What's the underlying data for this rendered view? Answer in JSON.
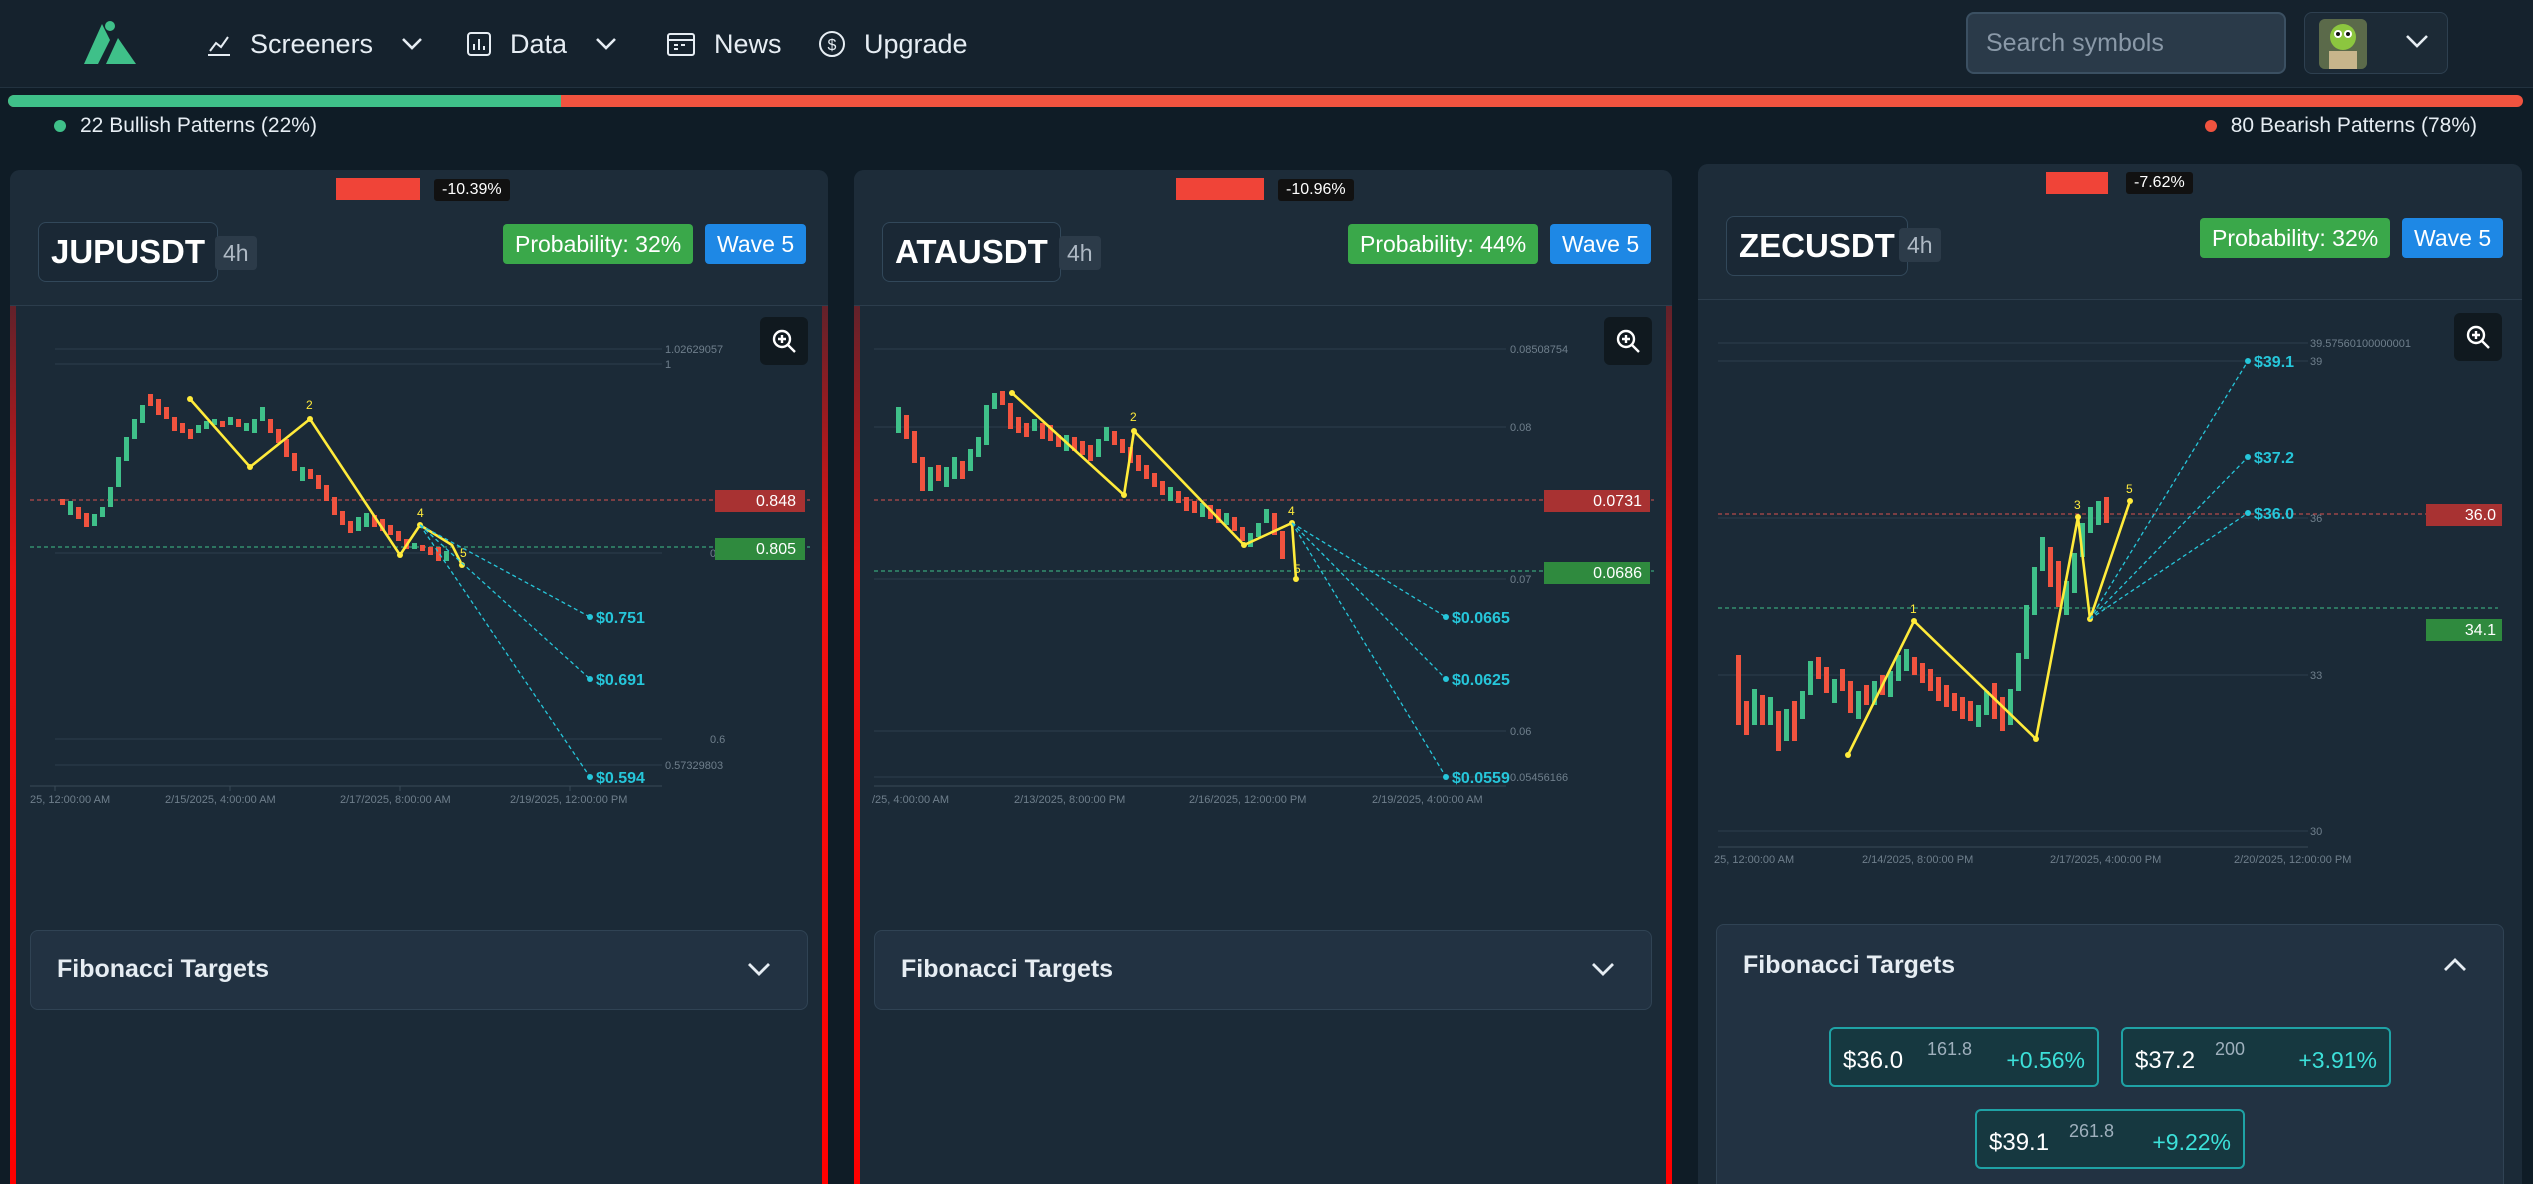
{
  "nav": {
    "items": [
      {
        "label": "Screeners",
        "icon": "chart-line-icon",
        "has_dropdown": true
      },
      {
        "label": "Data",
        "icon": "bar-chart-icon",
        "has_dropdown": true
      },
      {
        "label": "News",
        "icon": "calendar-icon",
        "has_dropdown": false
      },
      {
        "label": "Upgrade",
        "icon": "dollar-circle-icon",
        "has_dropdown": false
      }
    ],
    "search_placeholder": "Search symbols"
  },
  "sentiment": {
    "bullish_fraction": 0.22,
    "bullish_label": "22 Bullish Patterns (22%)",
    "bearish_label": "80 Bearish Patterns (78%)",
    "bull_color": "#3fc089",
    "bear_color": "#f0533f"
  },
  "cards": [
    {
      "symbol": "JUPUSDT",
      "timeframe": "4h",
      "change": "-10.39%",
      "probability": "Probability: 32%",
      "wave": "Wave 5",
      "fib_title": "Fibonacci Targets",
      "fib_expanded": false,
      "chart": {
        "y_ticks": [
          "1.02629057",
          "1",
          "0.8",
          "0.6",
          "0.57329803"
        ],
        "x_ticks": [
          "25, 12:00:00 AM",
          "2/15/2025, 4:00:00 AM",
          "2/17/2025, 8:00:00 AM",
          "2/19/2025, 12:00:00 PM"
        ],
        "resistance": "0.848",
        "support": "0.805",
        "targets": [
          "$0.751",
          "$0.691",
          "$0.594"
        ],
        "wave_labels": [
          "2",
          "4",
          "5"
        ]
      }
    },
    {
      "symbol": "ATAUSDT",
      "timeframe": "4h",
      "change": "-10.96%",
      "probability": "Probability: 44%",
      "wave": "Wave 5",
      "fib_title": "Fibonacci Targets",
      "fib_expanded": false,
      "chart": {
        "y_ticks": [
          "0.08508754",
          "0.08",
          "0.07",
          "0.06",
          "0.05456166"
        ],
        "x_ticks": [
          "/25, 4:00:00 AM",
          "2/13/2025, 8:00:00 PM",
          "2/16/2025, 12:00:00 PM",
          "2/19/2025, 4:00:00 AM"
        ],
        "resistance": "0.0731",
        "support": "0.0686",
        "targets": [
          "$0.0665",
          "$0.0625",
          "$0.0559"
        ],
        "wave_labels": [
          "2",
          "4",
          "5"
        ]
      }
    },
    {
      "symbol": "ZECUSDT",
      "timeframe": "4h",
      "change": "-7.62%",
      "probability": "Probability: 32%",
      "wave": "Wave 5",
      "fib_title": "Fibonacci Targets",
      "fib_expanded": true,
      "chart": {
        "y_ticks": [
          "39.57560100000001",
          "39",
          "36",
          "33",
          "30"
        ],
        "x_ticks": [
          "25, 12:00:00 AM",
          "2/14/2025, 8:00:00 PM",
          "2/17/2025, 4:00:00 PM",
          "2/20/2025, 12:00:00 PM"
        ],
        "resistance": "36.0",
        "support": "34.1",
        "targets": [
          "$39.1",
          "$37.2",
          "$36.0"
        ],
        "wave_labels": [
          "1",
          "3",
          "5"
        ]
      },
      "fib_targets": [
        {
          "price": "$36.0",
          "ratio": "161.8",
          "pct": "+0.56%"
        },
        {
          "price": "$37.2",
          "ratio": "200",
          "pct": "+3.91%"
        },
        {
          "price": "$39.1",
          "ratio": "261.8",
          "pct": "+9.22%"
        }
      ]
    }
  ]
}
